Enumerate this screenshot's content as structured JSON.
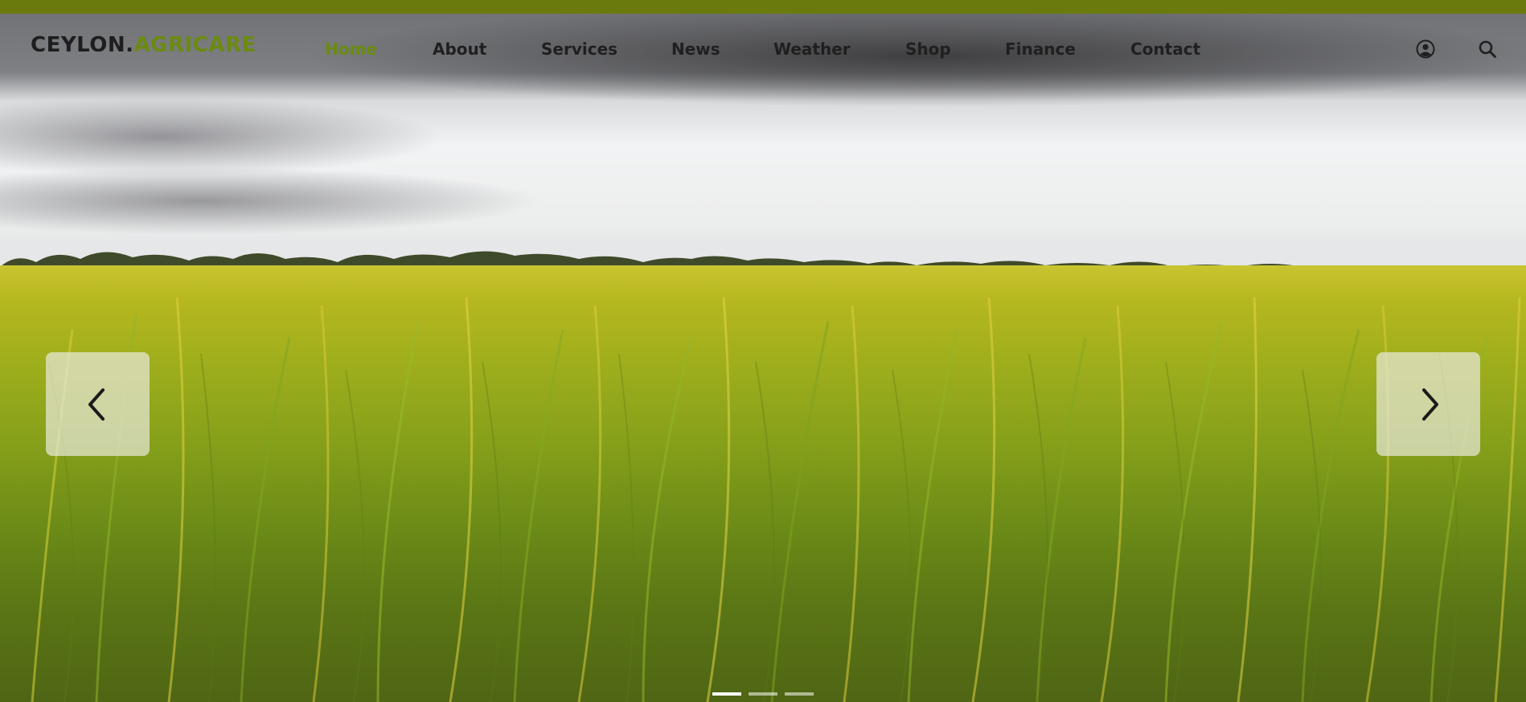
{
  "brand": {
    "name_part1": "CEYLON.",
    "name_part2": "AGRICARE",
    "accent_color": "#6b8a10",
    "topbar_color": "#6b7a0c"
  },
  "nav": {
    "items": [
      {
        "label": "Home",
        "active": true
      },
      {
        "label": "About",
        "active": false
      },
      {
        "label": "Services",
        "active": false
      },
      {
        "label": "News",
        "active": false
      },
      {
        "label": "Weather",
        "active": false
      },
      {
        "label": "Shop",
        "active": false
      },
      {
        "label": "Finance",
        "active": false
      },
      {
        "label": "Contact",
        "active": false
      }
    ]
  },
  "header_icons": {
    "user": "user-circle-icon",
    "search": "search-icon"
  },
  "slider": {
    "prev_icon": "chevron-left-icon",
    "next_icon": "chevron-right-icon",
    "slide_count": 3,
    "active_slide": 1
  }
}
